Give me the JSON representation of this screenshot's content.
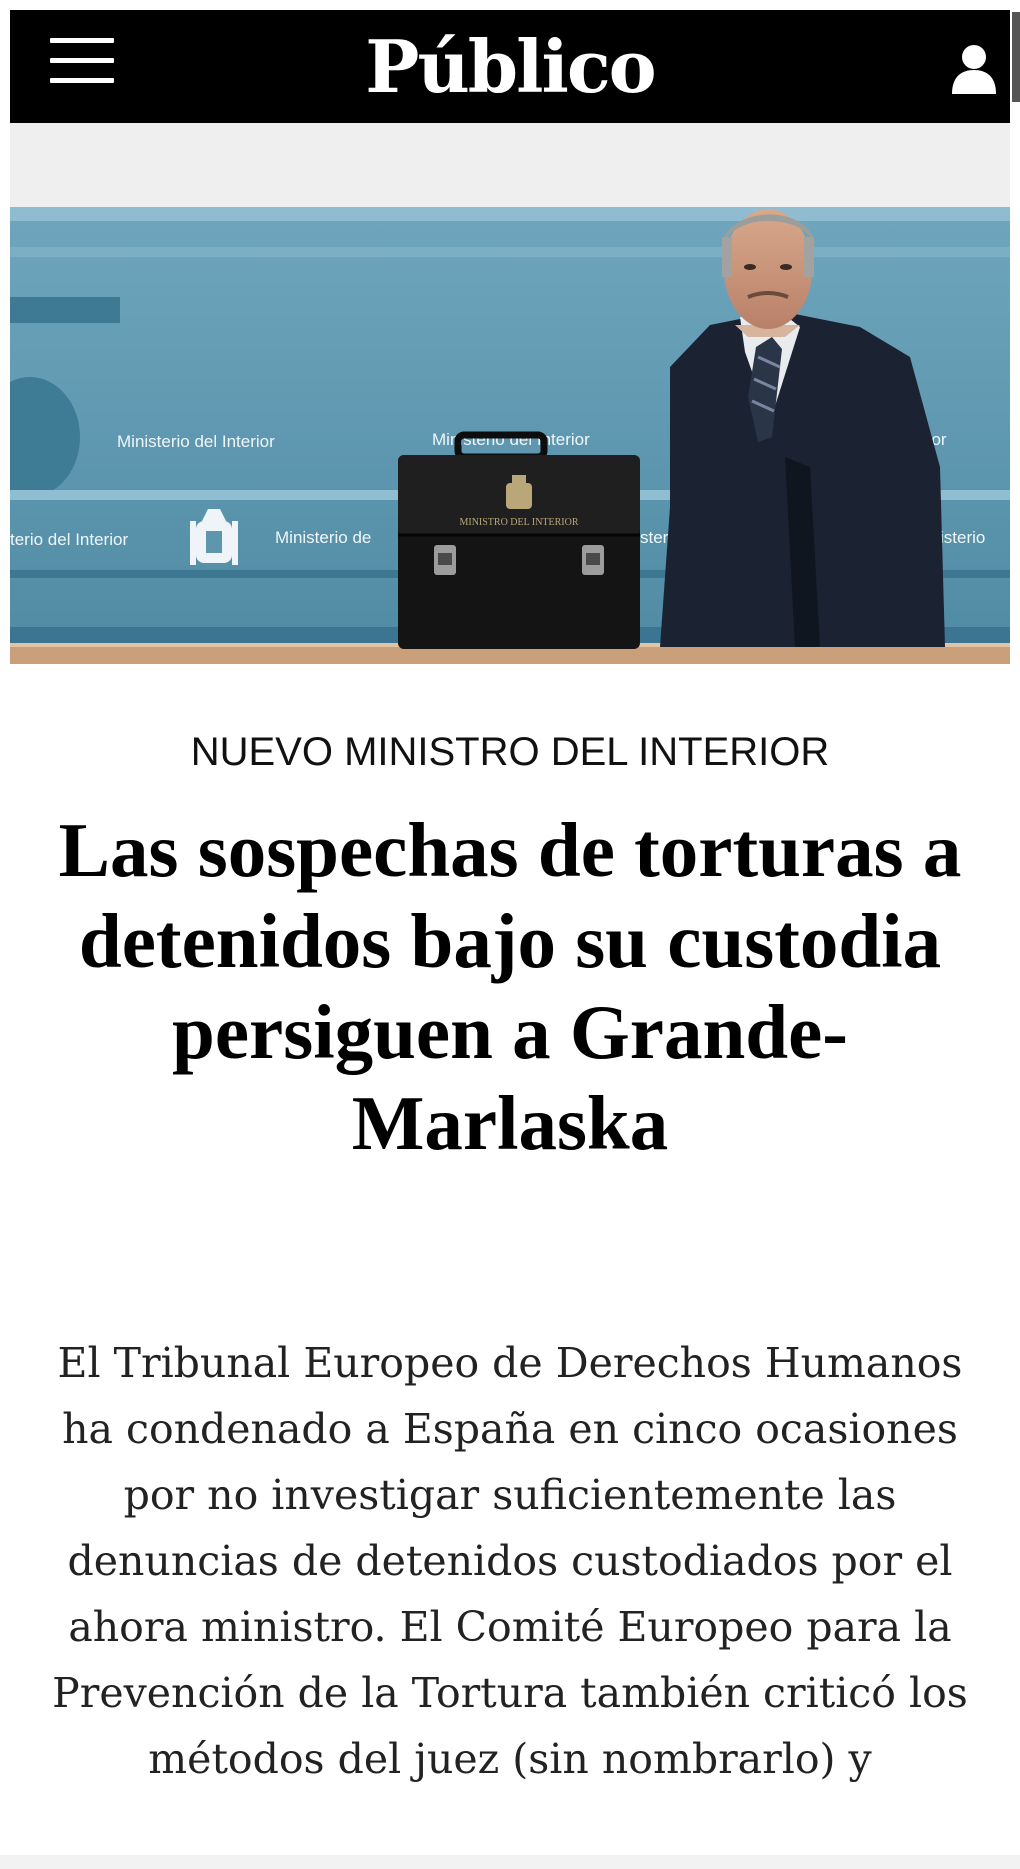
{
  "header": {
    "logo": "Público",
    "menu_icon": "hamburger-menu-icon",
    "user_icon": "user-icon"
  },
  "hero": {
    "backdrop_text": [
      "Ministerio del Interior",
      "Ministerio del Interior",
      "rior",
      "terio del Interior",
      "Ministerio de",
      "sterio",
      "isterio"
    ],
    "briefcase_text": "MINISTRO DEL INTERIOR",
    "colors": {
      "backdrop": "#5b93ab",
      "floor": "#c9a07a",
      "suit": "#1b2333"
    }
  },
  "article": {
    "kicker": "NUEVO MINISTRO DEL INTERIOR",
    "headline": "Las sospechas de torturas a detenidos bajo su custodia persiguen a Grande-Marlaska",
    "lede": "El Tribunal Europeo de Derechos Humanos ha condenado a España en cinco ocasiones por no investigar suficientemente las denuncias de detenidos custodiados por el ahora ministro. El Comité Europeo para la Prevención de la Tortura también criticó los métodos del juez (sin nombrarlo) y"
  }
}
